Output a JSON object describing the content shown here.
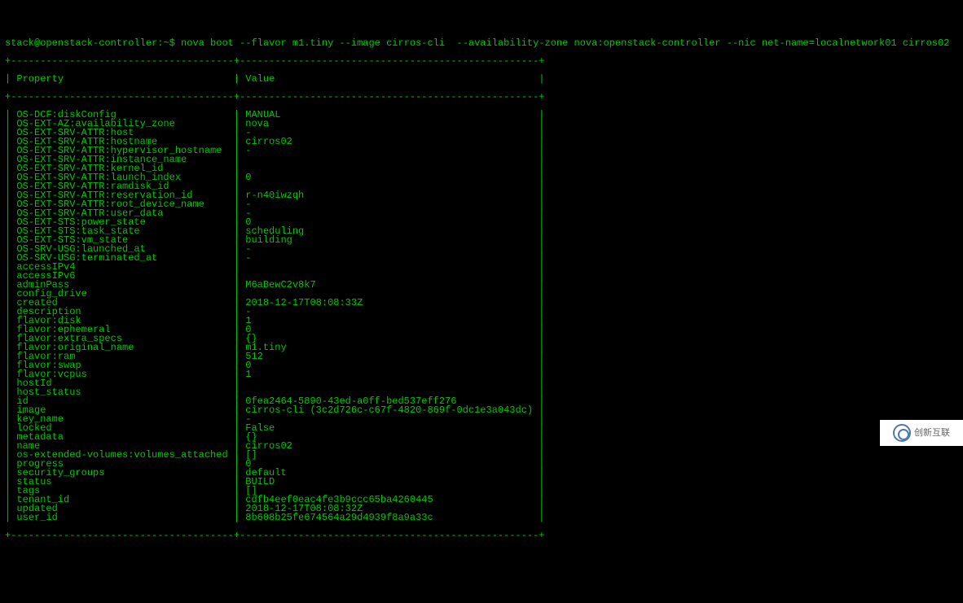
{
  "prompt": "stack@openstack-controller:~$ ",
  "command": "nova boot --flavor m1.tiny --image cirros-cli  --availability-zone nova:openstack-controller --nic net-name=localnetwork01 cirros02",
  "headers": {
    "property": "Property",
    "value": "Value"
  },
  "borders": {
    "top": "+--------------------------------------+---------------------------------------------------+",
    "header": "+--------------------------------------+---------------------------------------------------+",
    "bottom": "+--------------------------------------+---------------------------------------------------+"
  },
  "rows": [
    {
      "prop": "OS-DCF:diskConfig",
      "val": "MANUAL"
    },
    {
      "prop": "OS-EXT-AZ:availability_zone",
      "val": "nova"
    },
    {
      "prop": "OS-EXT-SRV-ATTR:host",
      "val": "-"
    },
    {
      "prop": "OS-EXT-SRV-ATTR:hostname",
      "val": "cirros02"
    },
    {
      "prop": "OS-EXT-SRV-ATTR:hypervisor_hostname",
      "val": "-"
    },
    {
      "prop": "OS-EXT-SRV-ATTR:instance_name",
      "val": ""
    },
    {
      "prop": "OS-EXT-SRV-ATTR:kernel_id",
      "val": ""
    },
    {
      "prop": "OS-EXT-SRV-ATTR:launch_index",
      "val": "0"
    },
    {
      "prop": "OS-EXT-SRV-ATTR:ramdisk_id",
      "val": ""
    },
    {
      "prop": "OS-EXT-SRV-ATTR:reservation_id",
      "val": "r-n40iwzqh"
    },
    {
      "prop": "OS-EXT-SRV-ATTR:root_device_name",
      "val": "-"
    },
    {
      "prop": "OS-EXT-SRV-ATTR:user_data",
      "val": "-"
    },
    {
      "prop": "OS-EXT-STS:power_state",
      "val": "0"
    },
    {
      "prop": "OS-EXT-STS:task_state",
      "val": "scheduling"
    },
    {
      "prop": "OS-EXT-STS:vm_state",
      "val": "building"
    },
    {
      "prop": "OS-SRV-USG:launched_at",
      "val": "-"
    },
    {
      "prop": "OS-SRV-USG:terminated_at",
      "val": "-"
    },
    {
      "prop": "accessIPv4",
      "val": ""
    },
    {
      "prop": "accessIPv6",
      "val": ""
    },
    {
      "prop": "adminPass",
      "val": "M6aBewC2v8k7"
    },
    {
      "prop": "config_drive",
      "val": ""
    },
    {
      "prop": "created",
      "val": "2018-12-17T08:08:33Z"
    },
    {
      "prop": "description",
      "val": "-"
    },
    {
      "prop": "flavor:disk",
      "val": "1"
    },
    {
      "prop": "flavor:ephemeral",
      "val": "0"
    },
    {
      "prop": "flavor:extra_specs",
      "val": "{}"
    },
    {
      "prop": "flavor:original_name",
      "val": "m1.tiny"
    },
    {
      "prop": "flavor:ram",
      "val": "512"
    },
    {
      "prop": "flavor:swap",
      "val": "0"
    },
    {
      "prop": "flavor:vcpus",
      "val": "1"
    },
    {
      "prop": "hostId",
      "val": ""
    },
    {
      "prop": "host_status",
      "val": ""
    },
    {
      "prop": "id",
      "val": "0fea2464-5890-43ed-a0ff-bed537eff276"
    },
    {
      "prop": "image",
      "val": "cirros-cli (3c2d726c-c67f-4820-869f-0dc1e3a043dc)"
    },
    {
      "prop": "key_name",
      "val": "-"
    },
    {
      "prop": "locked",
      "val": "False"
    },
    {
      "prop": "metadata",
      "val": "{}"
    },
    {
      "prop": "name",
      "val": "cirros02"
    },
    {
      "prop": "os-extended-volumes:volumes_attached",
      "val": "[]"
    },
    {
      "prop": "progress",
      "val": "0"
    },
    {
      "prop": "security_groups",
      "val": "default"
    },
    {
      "prop": "status",
      "val": "BUILD"
    },
    {
      "prop": "tags",
      "val": "[]"
    },
    {
      "prop": "tenant_id",
      "val": "cdfb4eef0eac4fe3b9ccc65ba4260445"
    },
    {
      "prop": "updated",
      "val": "2018-12-17T08:08:32Z"
    },
    {
      "prop": "user_id",
      "val": "8b608b25fe674564a29d4939f8a9a33c"
    }
  ],
  "logo_text": "创新互联"
}
